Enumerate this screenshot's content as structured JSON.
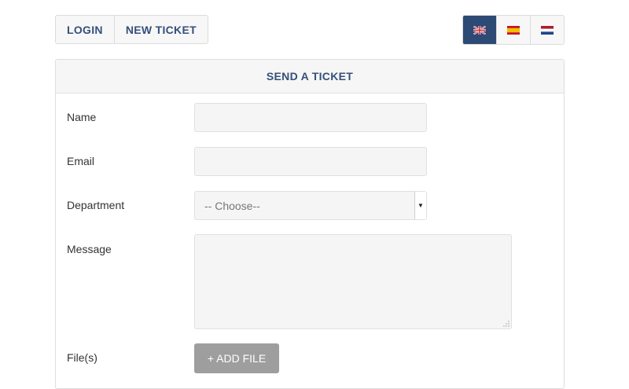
{
  "nav": {
    "login_label": "LOGIN",
    "new_ticket_label": "NEW TICKET"
  },
  "languages": [
    {
      "code": "en",
      "icon": "uk-flag-icon",
      "active": true
    },
    {
      "code": "es",
      "icon": "spain-flag-icon",
      "active": false
    },
    {
      "code": "nl",
      "icon": "netherlands-flag-icon",
      "active": false
    }
  ],
  "form": {
    "title": "SEND A TICKET",
    "name_label": "Name",
    "name_value": "",
    "email_label": "Email",
    "email_value": "",
    "department_label": "Department",
    "department_selected": "-- Choose--",
    "message_label": "Message",
    "message_value": "",
    "files_label": "File(s)",
    "add_file_label": "+ ADD FILE"
  },
  "colors": {
    "accent": "#2c4a73",
    "heading_text": "#34507a",
    "button_gray": "#9e9e9e"
  }
}
